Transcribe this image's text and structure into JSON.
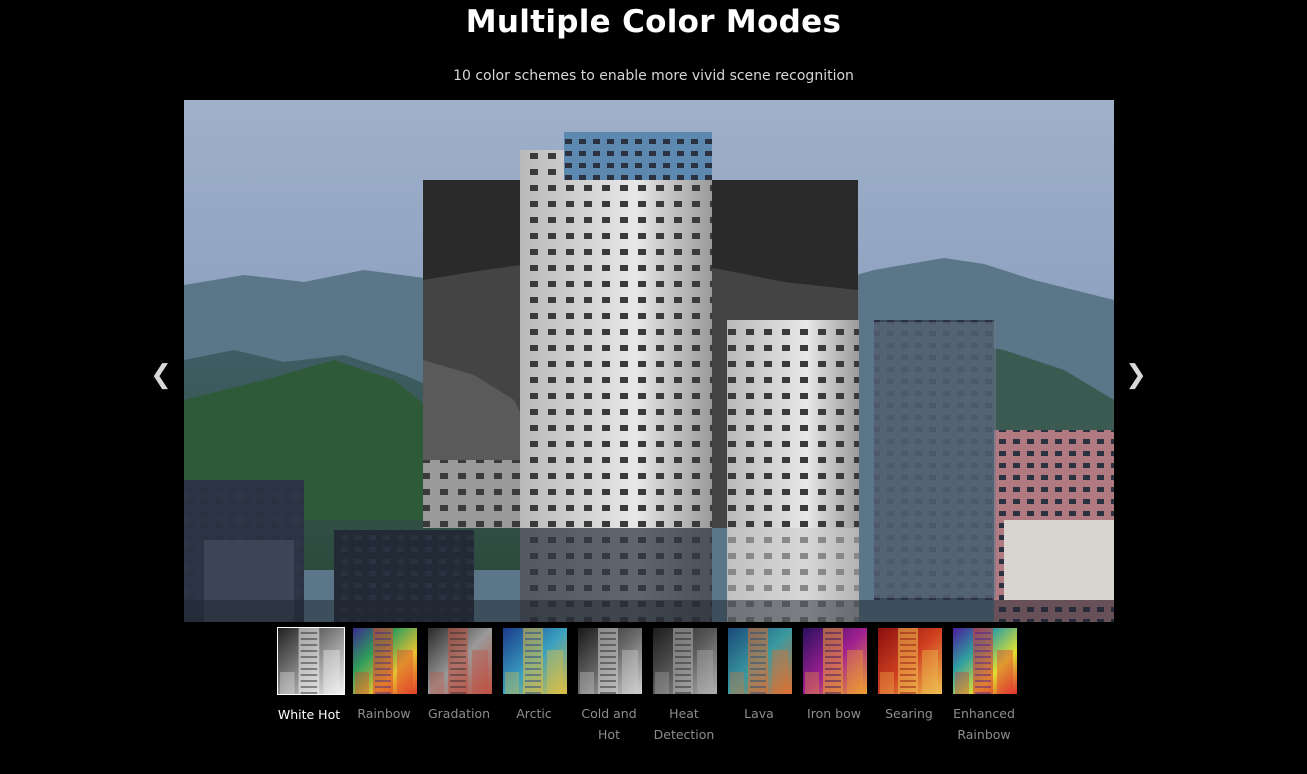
{
  "header": {
    "title": "Multiple Color Modes",
    "subtitle": "10 color schemes to enable more vivid scene recognition"
  },
  "navigation": {
    "prev_glyph": "❮",
    "next_glyph": "❯"
  },
  "modes": [
    {
      "label": "White Hot",
      "active": true,
      "palette": [
        "#202020",
        "#8a8a8a",
        "#f2f2f2"
      ]
    },
    {
      "label": "Rainbow",
      "active": false,
      "palette": [
        "#3a2a8c",
        "#2f9e5b",
        "#e8c030",
        "#e0402a"
      ]
    },
    {
      "label": "Gradation",
      "active": false,
      "palette": [
        "#2a2a2a",
        "#9a9a9a",
        "#c05040"
      ]
    },
    {
      "label": "Arctic",
      "active": false,
      "palette": [
        "#1a3a8c",
        "#3aa0c0",
        "#e0c040"
      ]
    },
    {
      "label": "Cold and Hot",
      "active": false,
      "palette": [
        "#1a1a1a",
        "#6a6a6a",
        "#d0d0d0"
      ]
    },
    {
      "label": "Heat Detection",
      "active": false,
      "palette": [
        "#1c1c1c",
        "#5a5a5a",
        "#b0b0b0"
      ]
    },
    {
      "label": "Lava",
      "active": false,
      "palette": [
        "#1a4a7a",
        "#3a9aa0",
        "#e07030"
      ]
    },
    {
      "label": "Iron bow",
      "active": false,
      "palette": [
        "#2a1060",
        "#a02090",
        "#f0a030"
      ]
    },
    {
      "label": "Searing",
      "active": false,
      "palette": [
        "#8a1010",
        "#d04020",
        "#f0c050"
      ]
    },
    {
      "label": "Enhanced Rainbow",
      "active": false,
      "palette": [
        "#4a1a9a",
        "#30a0a0",
        "#e0e030",
        "#e03030"
      ]
    }
  ],
  "theme": {
    "background": "#000000",
    "active_label": "#ffffff",
    "inactive_label": "#8d8d8d"
  }
}
